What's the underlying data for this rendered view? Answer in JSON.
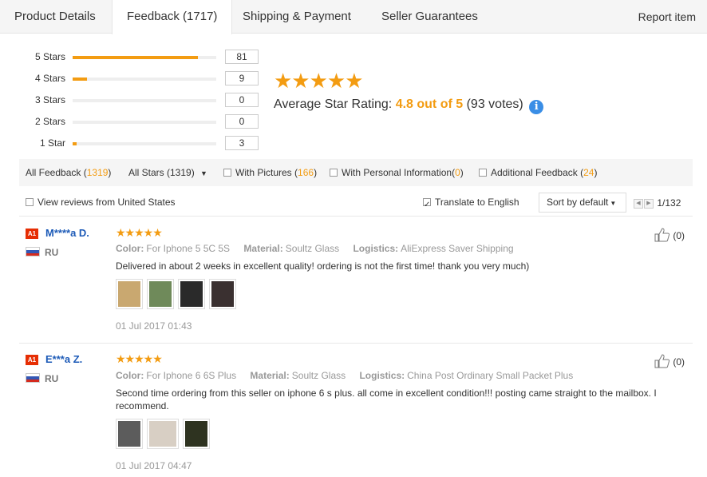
{
  "tabs": [
    {
      "label": "Product Details",
      "active": false
    },
    {
      "label": "Feedback (1717)",
      "active": true
    },
    {
      "label": "Shipping & Payment",
      "active": false
    },
    {
      "label": "Seller Guarantees",
      "active": false
    }
  ],
  "report_label": "Report item",
  "ratings": [
    {
      "label": "5 Stars",
      "count": "81",
      "fraction": 0.87
    },
    {
      "label": "4 Stars",
      "count": "9",
      "fraction": 0.1
    },
    {
      "label": "3 Stars",
      "count": "0",
      "fraction": 0
    },
    {
      "label": "2 Stars",
      "count": "0",
      "fraction": 0
    },
    {
      "label": "1 Star",
      "count": "3",
      "fraction": 0.03
    }
  ],
  "summary": {
    "stars": "★★★★★",
    "label": "Average Star Rating:",
    "score": "4.8 out of 5",
    "votes": "(93 votes)",
    "info_glyph": "i"
  },
  "filters": {
    "all_feedback": "All Feedback",
    "all_feedback_count": "1319",
    "all_stars": "All Stars (1319)",
    "with_pictures": "With Pictures",
    "with_pictures_count": "166",
    "personal_info": "With Personal Information",
    "personal_info_count": "0",
    "additional": "Additional Feedback",
    "additional_count": "24"
  },
  "options": {
    "view_us": "View reviews from United States",
    "translate": "Translate to English",
    "sort": "Sort by default",
    "page": "1/132"
  },
  "reviews": [
    {
      "badge": "A1",
      "name": "M****a D.",
      "country": "RU",
      "stars": "★★★★★",
      "color_label": "Color:",
      "color": "For Iphone 5 5C 5S",
      "material_label": "Material:",
      "material": "Soultz Glass",
      "logistics_label": "Logistics:",
      "logistics": "AliExpress Saver Shipping",
      "text": "Delivered in about 2 weeks in excellent quality! ordering is not the first time! thank you very much)",
      "date": "01 Jul 2017 01:43",
      "likes": "(0)",
      "thumb_colors": [
        "#c9a870",
        "#6f8a5a",
        "#2a2a2a",
        "#3a3030"
      ]
    },
    {
      "badge": "A1",
      "name": "E***a Z.",
      "country": "RU",
      "stars": "★★★★★",
      "color_label": "Color:",
      "color": "For Iphone 6 6S Plus",
      "material_label": "Material:",
      "material": "Soultz Glass",
      "logistics_label": "Logistics:",
      "logistics": "China Post Ordinary Small Packet Plus",
      "text": "Second time ordering from this seller on iphone 6 s plus. all come in excellent condition!!! posting came straight to the mailbox. I recommend.",
      "date": "01 Jul 2017 04:47",
      "likes": "(0)",
      "thumb_colors": [
        "#5c5c5c",
        "#d8cfc4",
        "#2e3320"
      ]
    }
  ],
  "colors": {
    "accent": "#f39c12",
    "name_link": "#1c5ab7",
    "badge": "#e62e04",
    "info": "#3a8ee6"
  }
}
